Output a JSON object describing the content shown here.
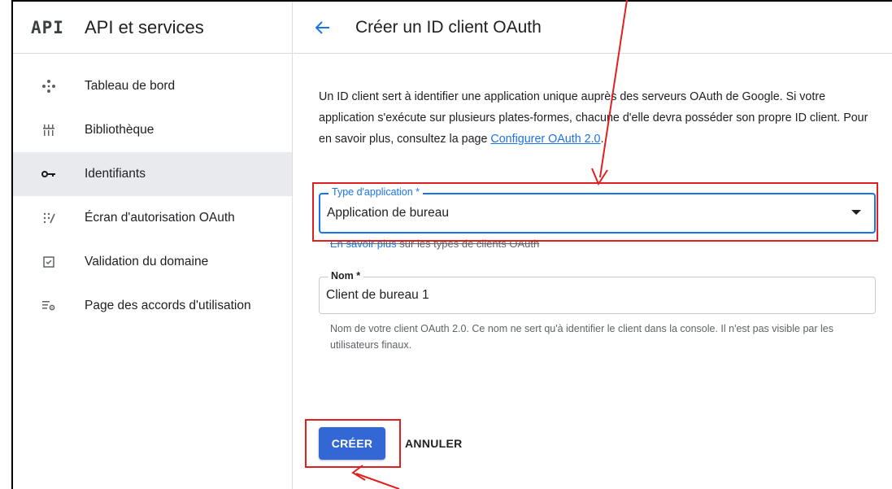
{
  "sidebar": {
    "logo": "API",
    "title": "API et services",
    "items": [
      {
        "label": "Tableau de bord",
        "icon": "dashboard-icon"
      },
      {
        "label": "Bibliothèque",
        "icon": "library-icon"
      },
      {
        "label": "Identifiants",
        "icon": "key-icon",
        "active": true
      },
      {
        "label": "Écran d'autorisation OAuth",
        "icon": "consent-screen-icon"
      },
      {
        "label": "Validation du domaine",
        "icon": "checkbox-icon"
      },
      {
        "label": "Page des accords d'utilisation",
        "icon": "settings-list-icon"
      }
    ]
  },
  "header": {
    "back_icon": "arrow-back-icon",
    "title": "Créer un ID client OAuth"
  },
  "description": {
    "text": "Un ID client sert à identifier une application unique auprès des serveurs OAuth de Google. Si votre application s'exécute sur plusieurs plates-formes, chacune d'elle devra posséder son propre ID client. Pour en savoir plus, consultez la page ",
    "link": "Configurer OAuth 2.0",
    "end": "."
  },
  "app_type": {
    "label": "Type d'application *",
    "value": "Application de bureau"
  },
  "hint": {
    "link": "En savoir plus",
    "text": " sur les types de clients OAuth"
  },
  "name_field": {
    "label": "Nom *",
    "value": "Client de bureau 1",
    "help": "Nom de votre client OAuth 2.0. Ce nom ne sert qu'à identifier le client dans la console. Il n'est pas visible par les utilisateurs finaux."
  },
  "actions": {
    "create": "CRÉER",
    "cancel": "ANNULER"
  },
  "colors": {
    "accent": "#1a73e8",
    "primary_button": "#3367d6",
    "annotation": "#e02020",
    "active_nav": "#e8eaed"
  }
}
